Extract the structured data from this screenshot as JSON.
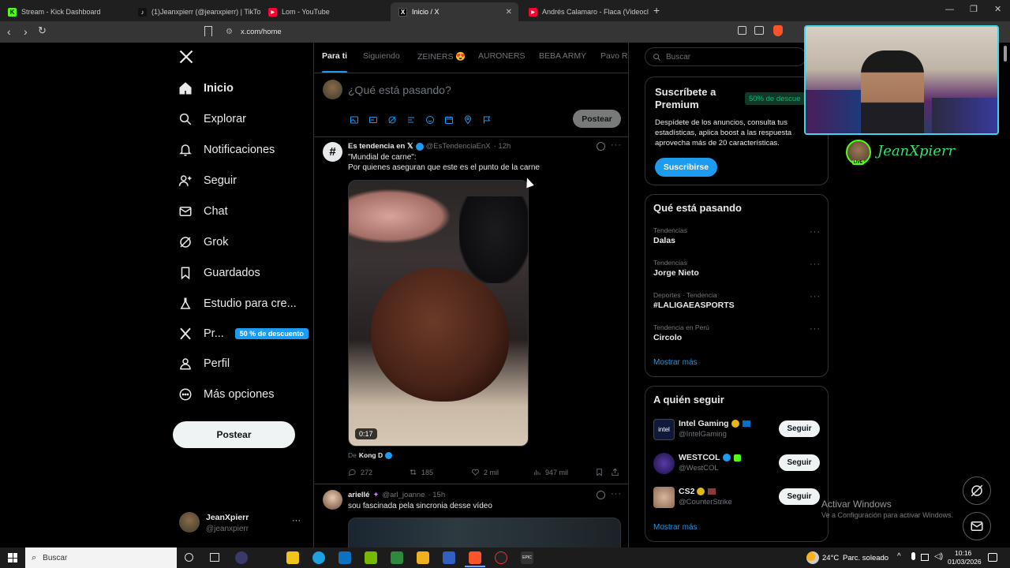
{
  "browser": {
    "tabs": [
      {
        "title": "Stream - Kick Dashboard",
        "color": "#53fc18",
        "glyph": "K"
      },
      {
        "title": "(1)Jeanxpierr (@jeanxpierr) | TikTok",
        "color": "#111111",
        "glyph": "♪"
      },
      {
        "title": "Lom - YouTube",
        "color": "#ff0033",
        "glyph": "▶"
      },
      {
        "title": "Inicio / X",
        "color": "#000000",
        "glyph": "X"
      },
      {
        "title": "Andrés Calamaro - Flaca (Videocl",
        "color": "#ff0033",
        "glyph": "▶"
      }
    ],
    "url": "x.com/home"
  },
  "nav": {
    "items": [
      {
        "label": "Inicio",
        "icon": "home-icon"
      },
      {
        "label": "Explorar",
        "icon": "search-icon"
      },
      {
        "label": "Notificaciones",
        "icon": "bell-icon"
      },
      {
        "label": "Seguir",
        "icon": "person-add-icon"
      },
      {
        "label": "Chat",
        "icon": "mail-icon"
      },
      {
        "label": "Grok",
        "icon": "grok-icon"
      },
      {
        "label": "Guardados",
        "icon": "bookmark-icon"
      },
      {
        "label": "Estudio para cre...",
        "icon": "flask-icon"
      },
      {
        "label": "Pr...",
        "icon": "x-logo-icon"
      },
      {
        "label": "Perfil",
        "icon": "person-icon"
      },
      {
        "label": "Más opciones",
        "icon": "more-icon"
      }
    ],
    "premium_badge": "50 % de descuento",
    "post_button": "Postear",
    "account": {
      "name": "JeanXpierr",
      "handle": "@jeanxpierr",
      "menu": "···"
    }
  },
  "feed": {
    "tabs": [
      "Para ti",
      "Siguiendo",
      "ZEINERS 😍",
      "AURONERS",
      "BEBA ARMY",
      "Pavo Ra"
    ],
    "composer": {
      "placeholder": "¿Qué está pasando?",
      "button": "Postear"
    },
    "post1": {
      "author": "Es tendencia en 𝕏",
      "handle": "@EsTendenciaEnX",
      "time": "· 12h",
      "line1": "\"Mundial de carne\":",
      "line2": "Por quienes aseguran que este es el punto de la carne",
      "video_duration": "0:17",
      "source_prefix": "De",
      "source_name": "Kong D",
      "replies": "272",
      "reposts": "185",
      "likes": "2 mil",
      "views": "947 mil"
    },
    "post2": {
      "author": "ariellé",
      "handle": "@arl_joanne",
      "time": "· 15h",
      "text": "sou fascinada pela sincronia desse vídeo"
    }
  },
  "search": {
    "placeholder": "Buscar"
  },
  "premium": {
    "title": "Suscríbete a Premium",
    "badge": "50% de descue",
    "body": "Despídete de los anuncios, consulta tus estadísticas, aplica boost a las respuesta aprovecha más de 20 características.",
    "button": "Suscribirse"
  },
  "trends": {
    "title": "Qué está pasando",
    "items": [
      {
        "category": "Tendencias",
        "name": "Dalas"
      },
      {
        "category": "Tendencias",
        "name": "Jorge Nieto"
      },
      {
        "category": "Deportes · Tendencia",
        "name": "#LALIGAEASPORTS"
      },
      {
        "category": "Tendencia en Perú",
        "name": "Circolo"
      }
    ],
    "more": "Mostrar más"
  },
  "who_to_follow": {
    "title": "A quién seguir",
    "items": [
      {
        "name": "Intel Gaming",
        "handle": "@IntelGaming",
        "button": "Seguir"
      },
      {
        "name": "WESTCOL",
        "handle": "@WestCOL",
        "button": "Seguir"
      },
      {
        "name": "CS2",
        "handle": "@CounterStrike",
        "button": "Seguir"
      }
    ],
    "more": "Mostrar más"
  },
  "overlay": {
    "streamer_name": "JeanXpierr",
    "live": "LIVE"
  },
  "watermark": {
    "line1": "Activar Windows",
    "line2": "Ve a Configuración para activar Windows."
  },
  "taskbar": {
    "search": "Buscar",
    "temp": "24°C",
    "weather": "Parc. soleado",
    "time": "10:16",
    "date": "01/03/2026"
  },
  "colors": {
    "accent": "#1d9bf0",
    "background": "#000000",
    "border": "#2f3336",
    "muted": "#71767b"
  }
}
